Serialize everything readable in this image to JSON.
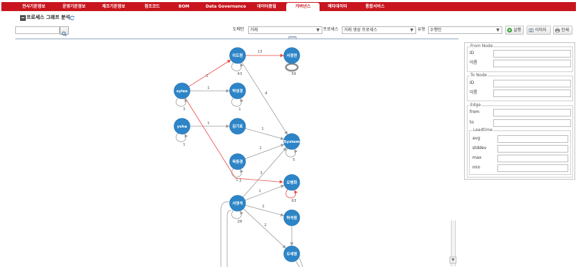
{
  "nav": {
    "items": [
      "전사기준정보",
      "운영기준정보",
      "제조기준정보",
      "참조코드",
      "BOM",
      "Data Governance",
      "데이터품질",
      "거버넌스",
      "메타데이터",
      "통합서비스"
    ],
    "active_index": 7
  },
  "page": {
    "title": "프로세스 그래프 분석",
    "title_icon": "process-graph-icon",
    "refresh_icon": "refresh-icon"
  },
  "toolbar": {
    "search_icon": "search-icon",
    "domain": {
      "label": "도메인",
      "value": "거래"
    },
    "process": {
      "label": "프로세스",
      "value": "거래 생성 프로세스"
    },
    "type": {
      "label": "유형",
      "value": "수행인"
    },
    "buttons": [
      {
        "label": "실행",
        "icon": "run-icon"
      },
      {
        "label": "이미지",
        "icon": "image-icon"
      },
      {
        "label": "인쇄",
        "icon": "print-icon"
      }
    ]
  },
  "graph": {
    "nodes": [
      {
        "label": "이도현",
        "self_loop": "43"
      },
      {
        "label": "서정연",
        "self_loop": "56"
      },
      {
        "label": "sylee",
        "self_loop": "3"
      },
      {
        "label": "박성경",
        "self_loop": "1"
      },
      {
        "label": "ysha",
        "self_loop": "1"
      },
      {
        "label": "김기표"
      },
      {
        "label": "육동경",
        "self_loop": "1"
      },
      {
        "label": "System",
        "self_loop": "5"
      },
      {
        "label": "오병화",
        "self_loop": "63",
        "self_loop_color": "#e8473f"
      },
      {
        "label": "서영석",
        "self_loop": "28"
      },
      {
        "label": "허석원"
      },
      {
        "label": "오세영"
      }
    ],
    "edges": [
      {
        "from": "sylee",
        "to": "이도현",
        "label": "1",
        "color": "#e8473f"
      },
      {
        "from": "이도현",
        "to": "서정연",
        "label": "13",
        "color": "#e8473f"
      },
      {
        "from": "sylee",
        "to": "박성경",
        "label": "1",
        "color": "#9a9a9a"
      },
      {
        "from": "ysha",
        "to": "김기표",
        "label": "1",
        "color": "#9a9a9a"
      },
      {
        "from": "sylee",
        "to": "오병화",
        "label": "2",
        "color": "#e8473f"
      },
      {
        "from": "이도현",
        "to": "System",
        "label": "4",
        "color": "#9a9a9a"
      },
      {
        "from": "김기표",
        "to": "System",
        "label": "1",
        "color": "#9a9a9a"
      },
      {
        "from": "육동경",
        "to": "System",
        "label": "1",
        "color": "#9a9a9a"
      },
      {
        "from": "서영석",
        "to": "System",
        "label": "3",
        "color": "#9a9a9a"
      },
      {
        "from": "서영석",
        "to": "오병화",
        "label": "1",
        "color": "#9a9a9a"
      },
      {
        "from": "서영석",
        "to": "허석원",
        "label": "2",
        "color": "#9a9a9a"
      },
      {
        "from": "서영석",
        "to": "오세영",
        "label": "2",
        "color": "#9a9a9a"
      },
      {
        "from": "허석원",
        "to": "오세영",
        "color": "#9a9a9a"
      }
    ]
  },
  "detail": {
    "from_node": {
      "legend": "From Node",
      "id_label": "ID",
      "name_label": "이름"
    },
    "to_node": {
      "legend": "To Node",
      "id_label": "ID",
      "name_label": "이름"
    },
    "edge": {
      "legend": "Edge",
      "from_label": "from",
      "to_label": "to",
      "leadtime": {
        "legend": "Leadtime",
        "avg_label": "avg",
        "stddev_label": "stddev",
        "max_label": "max",
        "min_label": "min"
      }
    }
  },
  "colors": {
    "nav": "#c8151e",
    "node": "#2d85c7",
    "edge_red": "#e8473f",
    "edge_gray": "#9a9a9a",
    "run": "#3aa33a"
  }
}
